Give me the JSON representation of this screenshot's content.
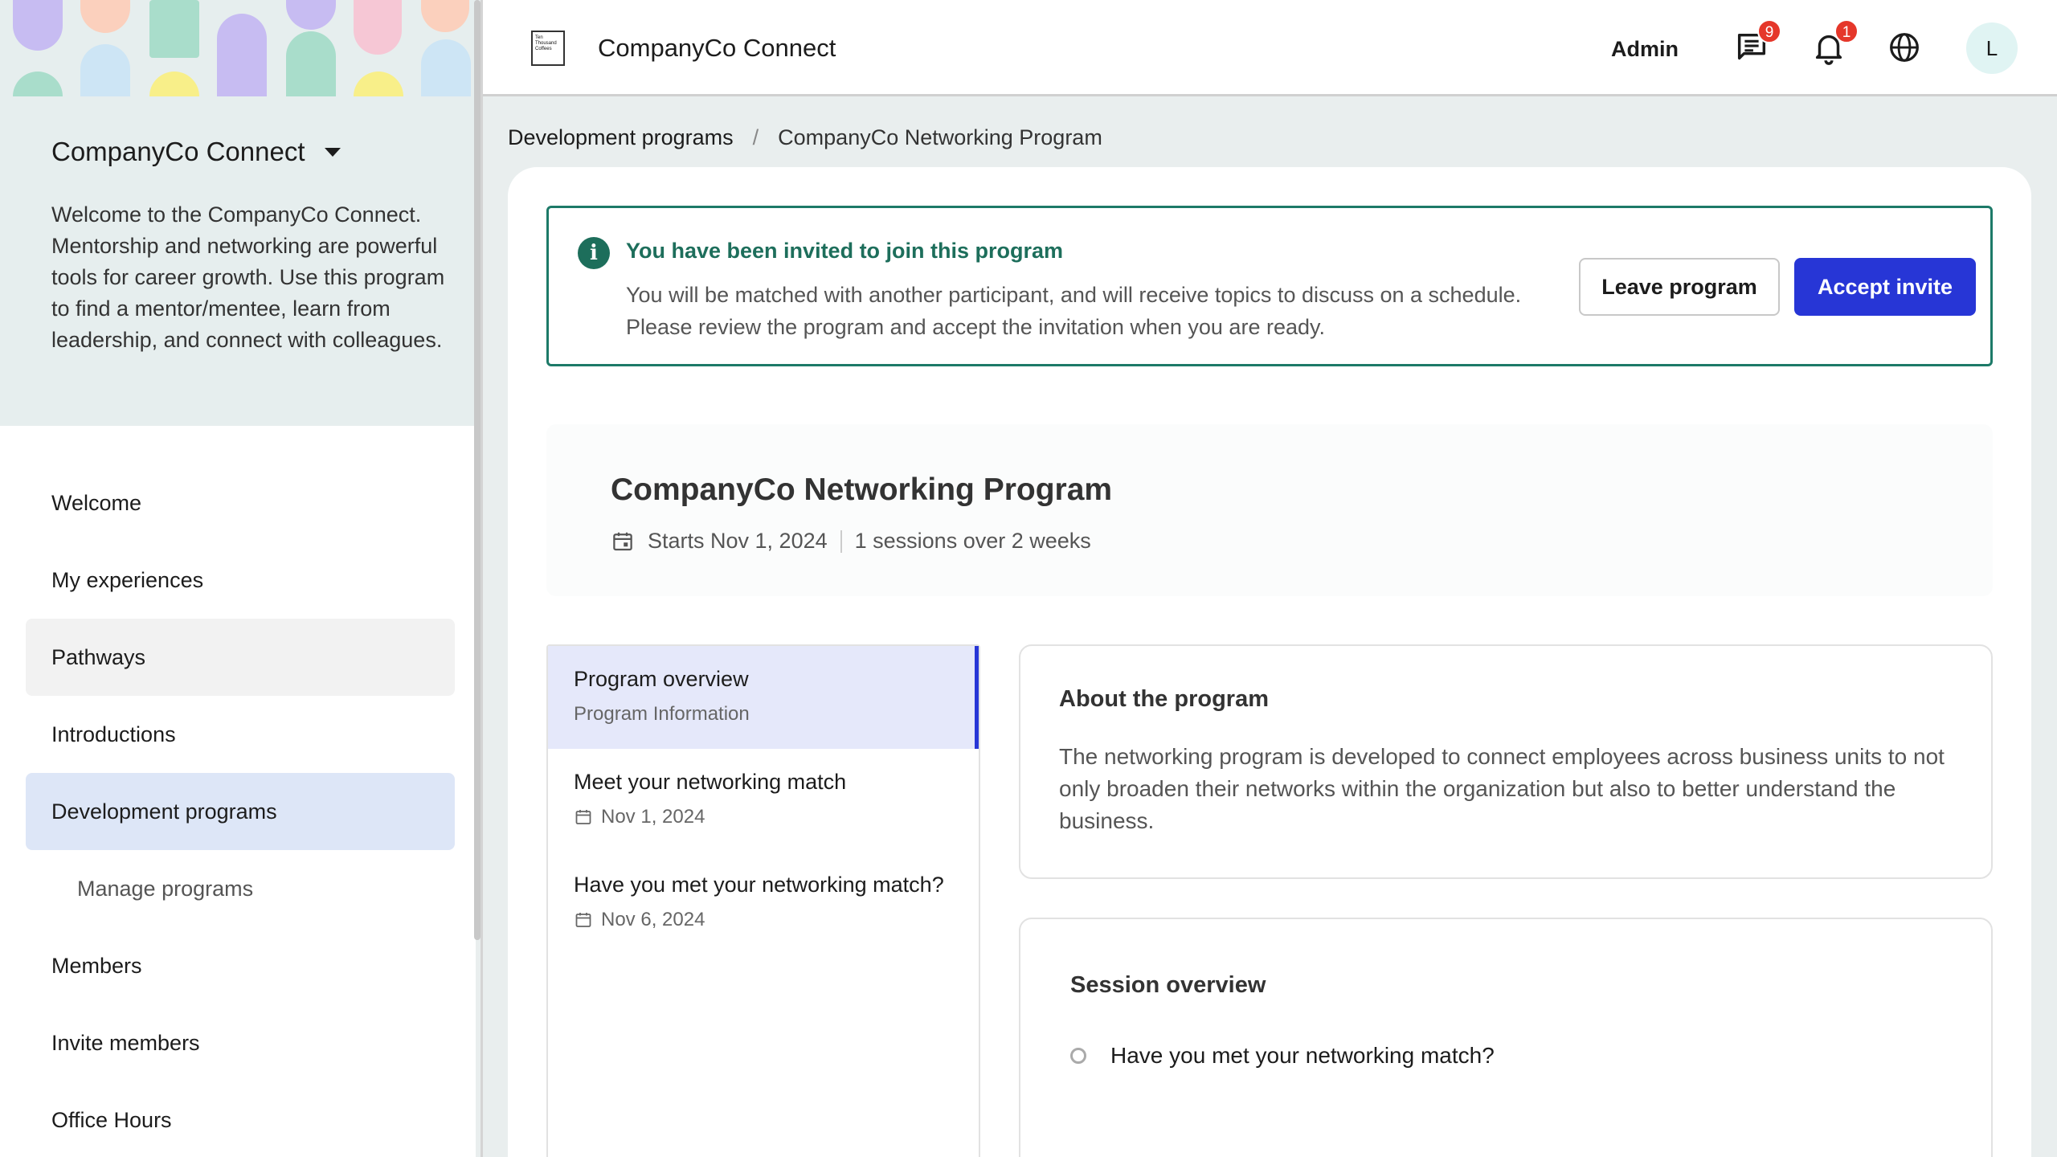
{
  "sidebar": {
    "community_name": "CompanyCo Connect",
    "description": "Welcome to the CompanyCo Connect. Mentorship and networking are powerful tools for career growth. Use this program to find a mentor/mentee, learn from leadership, and connect with colleagues.",
    "items": [
      {
        "label": "Welcome"
      },
      {
        "label": "My experiences"
      },
      {
        "label": "Pathways"
      },
      {
        "label": "Introductions"
      },
      {
        "label": "Development programs"
      },
      {
        "label": "Manage programs"
      },
      {
        "label": "Members"
      },
      {
        "label": "Invite members"
      },
      {
        "label": "Office Hours"
      }
    ]
  },
  "topbar": {
    "logo_text": "Ten Thousand Coffees",
    "app_title": "CompanyCo Connect",
    "admin_label": "Admin",
    "messages_badge": "9",
    "notifications_badge": "1",
    "avatar_initial": "L"
  },
  "breadcrumb": {
    "parent": "Development programs",
    "separator": "/",
    "current": "CompanyCo Networking Program"
  },
  "invite": {
    "title": "You have been invited to join this program",
    "body": "You will be matched with another participant, and will receive topics to discuss on a schedule. Please review the program and accept the invitation when you are ready.",
    "leave_label": "Leave program",
    "accept_label": "Accept invite"
  },
  "program": {
    "title": "CompanyCo Networking Program",
    "starts": "Starts Nov 1, 2024",
    "sessions_info": "1 sessions over 2 weeks"
  },
  "sessions": [
    {
      "title": "Program overview",
      "sub": "Program Information"
    },
    {
      "title": "Meet your networking match",
      "sub": "Nov 1, 2024"
    },
    {
      "title": "Have you met your networking match?",
      "sub": "Nov 6, 2024"
    }
  ],
  "about": {
    "title": "About the program",
    "text": "The networking program is developed to connect employees across business units to not only broaden their networks within the organization but also to better understand the business."
  },
  "overview": {
    "title": "Session overview",
    "items": [
      {
        "label": "Have you met your networking match?"
      }
    ]
  },
  "colors": {
    "accent": "#2736d6",
    "success": "#1d6e5b",
    "badge": "#e5372a"
  }
}
